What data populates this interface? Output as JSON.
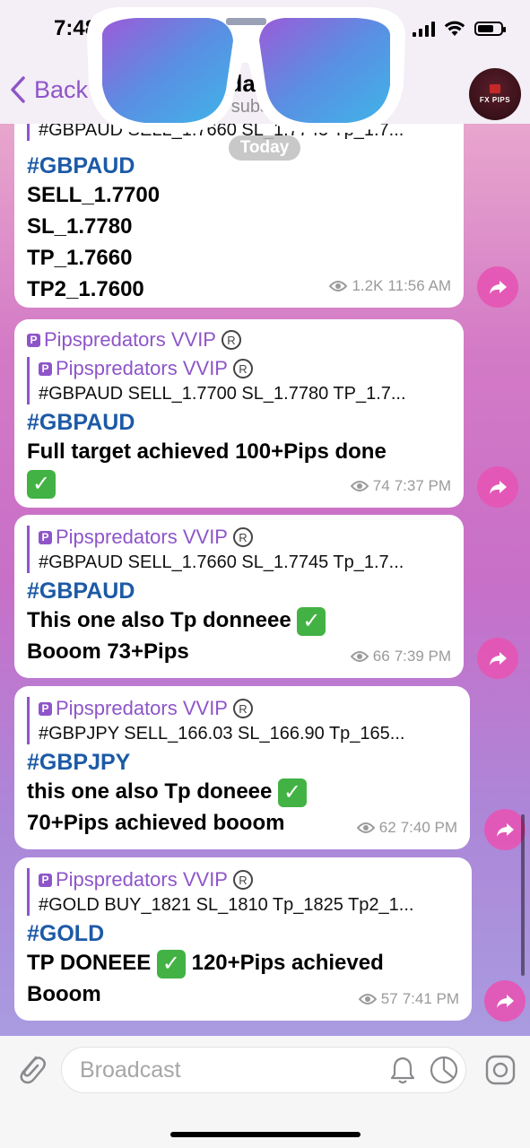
{
  "status": {
    "time": "7:48"
  },
  "header": {
    "back_label": "Back",
    "title": "eda",
    "subtitle": "75 subsc",
    "avatar_text": "FX PIPS"
  },
  "chat": {
    "date_badge": "Today",
    "messages": [
      {
        "quote_text": "#GBPAUD SELL_1.7660 SL_1.7745 Tp_1.7...",
        "tag": "#GBPAUD",
        "lines": [
          "SELL_1.7700",
          "SL_1.7780",
          "TP_1.7660",
          "TP2_1.7600"
        ],
        "views": "1.2K",
        "time": "11:56 AM"
      },
      {
        "sender": "Pipspredators VVIP",
        "quote_name": "Pipspredators VVIP",
        "quote_text": "#GBPAUD SELL_1.7700 SL_1.7780 TP_1.7...",
        "tag": "#GBPAUD",
        "line1": "Full target achieved 100+Pips done",
        "views": "74",
        "time": "7:37 PM"
      },
      {
        "quote_name": "Pipspredators VVIP",
        "quote_text": "#GBPAUD SELL_1.7660 SL_1.7745 Tp_1.7...",
        "tag": "#GBPAUD",
        "line1": "This one also Tp donneee",
        "line2": "Booom 73+Pips",
        "views": "66",
        "time": "7:39 PM"
      },
      {
        "quote_name": "Pipspredators VVIP",
        "quote_text": "#GBPJPY SELL_166.03 SL_166.90 Tp_165...",
        "tag": "#GBPJPY",
        "line1": "this one also Tp doneee",
        "line2": "70+Pips achieved booom",
        "views": "62",
        "time": "7:40 PM"
      },
      {
        "quote_name": "Pipspredators VVIP",
        "quote_text": "#GOLD BUY_1821 SL_1810 Tp_1825 Tp2_1...",
        "tag": "#GOLD",
        "line1a": "TP DONEEE",
        "line1b": "120+Pips achieved",
        "line2": "Booom",
        "views": "57",
        "time": "7:41 PM"
      }
    ]
  },
  "composer": {
    "placeholder": "Broadcast"
  },
  "colors": {
    "accent": "#8e55c9",
    "hashtag": "#1c5aa6",
    "forward": "#e654b4",
    "check": "#43b244"
  },
  "icons": [
    "chevron-left-icon",
    "eye-icon",
    "forward-icon",
    "paperclip-icon",
    "bell-icon",
    "timer-icon",
    "sticker-icon",
    "registered-icon",
    "check-mark-icon"
  ]
}
